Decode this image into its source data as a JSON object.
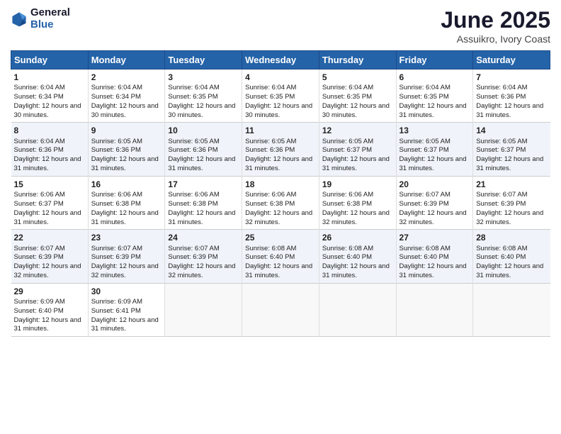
{
  "header": {
    "logo_line1": "General",
    "logo_line2": "Blue",
    "title": "June 2025",
    "location": "Assuikro, Ivory Coast"
  },
  "days_of_week": [
    "Sunday",
    "Monday",
    "Tuesday",
    "Wednesday",
    "Thursday",
    "Friday",
    "Saturday"
  ],
  "weeks": [
    [
      {
        "day": 1,
        "sunrise": "6:04 AM",
        "sunset": "6:34 PM",
        "daylight": "12 hours and 30 minutes."
      },
      {
        "day": 2,
        "sunrise": "6:04 AM",
        "sunset": "6:34 PM",
        "daylight": "12 hours and 30 minutes."
      },
      {
        "day": 3,
        "sunrise": "6:04 AM",
        "sunset": "6:35 PM",
        "daylight": "12 hours and 30 minutes."
      },
      {
        "day": 4,
        "sunrise": "6:04 AM",
        "sunset": "6:35 PM",
        "daylight": "12 hours and 30 minutes."
      },
      {
        "day": 5,
        "sunrise": "6:04 AM",
        "sunset": "6:35 PM",
        "daylight": "12 hours and 30 minutes."
      },
      {
        "day": 6,
        "sunrise": "6:04 AM",
        "sunset": "6:35 PM",
        "daylight": "12 hours and 31 minutes."
      },
      {
        "day": 7,
        "sunrise": "6:04 AM",
        "sunset": "6:36 PM",
        "daylight": "12 hours and 31 minutes."
      }
    ],
    [
      {
        "day": 8,
        "sunrise": "6:04 AM",
        "sunset": "6:36 PM",
        "daylight": "12 hours and 31 minutes."
      },
      {
        "day": 9,
        "sunrise": "6:05 AM",
        "sunset": "6:36 PM",
        "daylight": "12 hours and 31 minutes."
      },
      {
        "day": 10,
        "sunrise": "6:05 AM",
        "sunset": "6:36 PM",
        "daylight": "12 hours and 31 minutes."
      },
      {
        "day": 11,
        "sunrise": "6:05 AM",
        "sunset": "6:36 PM",
        "daylight": "12 hours and 31 minutes."
      },
      {
        "day": 12,
        "sunrise": "6:05 AM",
        "sunset": "6:37 PM",
        "daylight": "12 hours and 31 minutes."
      },
      {
        "day": 13,
        "sunrise": "6:05 AM",
        "sunset": "6:37 PM",
        "daylight": "12 hours and 31 minutes."
      },
      {
        "day": 14,
        "sunrise": "6:05 AM",
        "sunset": "6:37 PM",
        "daylight": "12 hours and 31 minutes."
      }
    ],
    [
      {
        "day": 15,
        "sunrise": "6:06 AM",
        "sunset": "6:37 PM",
        "daylight": "12 hours and 31 minutes."
      },
      {
        "day": 16,
        "sunrise": "6:06 AM",
        "sunset": "6:38 PM",
        "daylight": "12 hours and 31 minutes."
      },
      {
        "day": 17,
        "sunrise": "6:06 AM",
        "sunset": "6:38 PM",
        "daylight": "12 hours and 31 minutes."
      },
      {
        "day": 18,
        "sunrise": "6:06 AM",
        "sunset": "6:38 PM",
        "daylight": "12 hours and 32 minutes."
      },
      {
        "day": 19,
        "sunrise": "6:06 AM",
        "sunset": "6:38 PM",
        "daylight": "12 hours and 32 minutes."
      },
      {
        "day": 20,
        "sunrise": "6:07 AM",
        "sunset": "6:39 PM",
        "daylight": "12 hours and 32 minutes."
      },
      {
        "day": 21,
        "sunrise": "6:07 AM",
        "sunset": "6:39 PM",
        "daylight": "12 hours and 32 minutes."
      }
    ],
    [
      {
        "day": 22,
        "sunrise": "6:07 AM",
        "sunset": "6:39 PM",
        "daylight": "12 hours and 32 minutes."
      },
      {
        "day": 23,
        "sunrise": "6:07 AM",
        "sunset": "6:39 PM",
        "daylight": "12 hours and 32 minutes."
      },
      {
        "day": 24,
        "sunrise": "6:07 AM",
        "sunset": "6:39 PM",
        "daylight": "12 hours and 32 minutes."
      },
      {
        "day": 25,
        "sunrise": "6:08 AM",
        "sunset": "6:40 PM",
        "daylight": "12 hours and 31 minutes."
      },
      {
        "day": 26,
        "sunrise": "6:08 AM",
        "sunset": "6:40 PM",
        "daylight": "12 hours and 31 minutes."
      },
      {
        "day": 27,
        "sunrise": "6:08 AM",
        "sunset": "6:40 PM",
        "daylight": "12 hours and 31 minutes."
      },
      {
        "day": 28,
        "sunrise": "6:08 AM",
        "sunset": "6:40 PM",
        "daylight": "12 hours and 31 minutes."
      }
    ],
    [
      {
        "day": 29,
        "sunrise": "6:09 AM",
        "sunset": "6:40 PM",
        "daylight": "12 hours and 31 minutes."
      },
      {
        "day": 30,
        "sunrise": "6:09 AM",
        "sunset": "6:41 PM",
        "daylight": "12 hours and 31 minutes."
      },
      null,
      null,
      null,
      null,
      null
    ]
  ]
}
